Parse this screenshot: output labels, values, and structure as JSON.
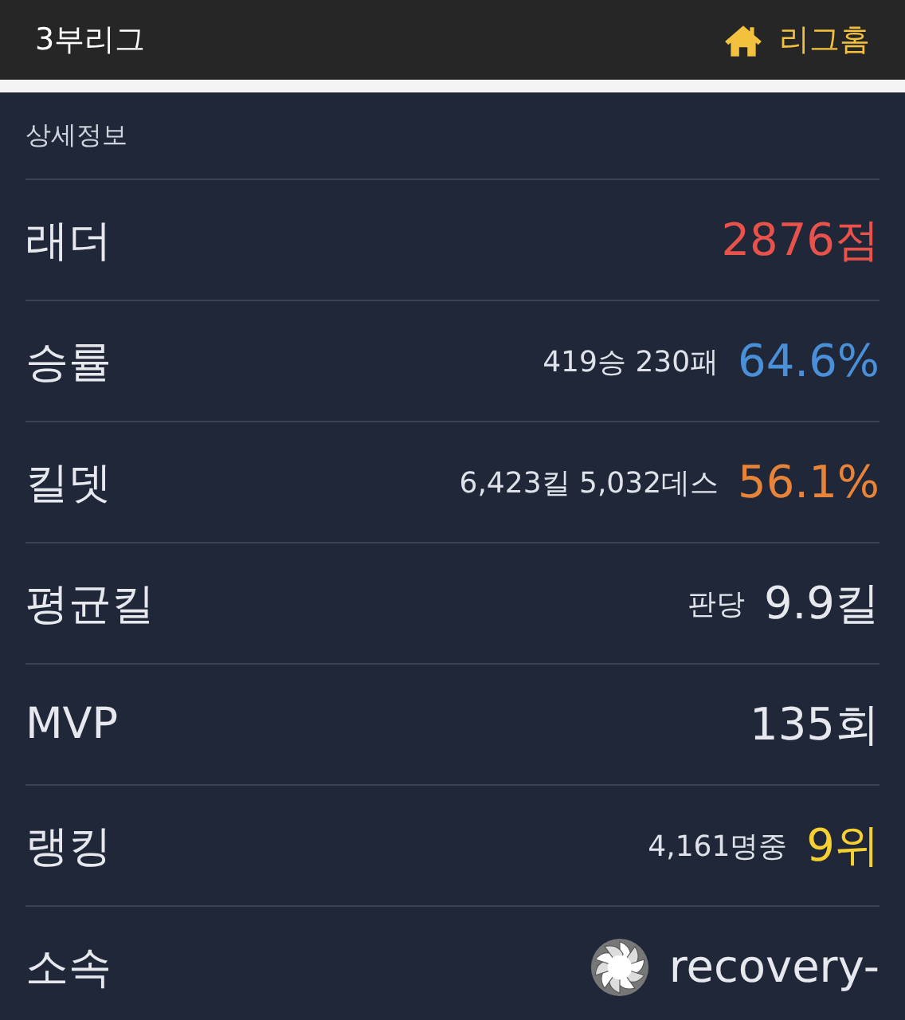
{
  "top_bar": {
    "title": "3부리그",
    "home_link": "리그홈"
  },
  "section": {
    "title": "상세정보"
  },
  "rows": [
    {
      "kind": "stat",
      "label": "래더",
      "detail": "",
      "value": "2876점",
      "color": "#e8524a"
    },
    {
      "kind": "stat",
      "label": "승률",
      "detail": "419승 230패",
      "value": "64.6%",
      "color": "#4a90d9"
    },
    {
      "kind": "stat",
      "label": "킬뎃",
      "detail": "6,423킬 5,032데스",
      "value": "56.1%",
      "color": "#e8833a"
    },
    {
      "kind": "stat",
      "label": "평균킬",
      "detail": "판당",
      "value": "9.9킬",
      "color": "#e6e8ee"
    },
    {
      "kind": "stat",
      "label": "MVP",
      "detail": "",
      "value": "135회",
      "color": "#e6e8ee"
    },
    {
      "kind": "stat",
      "label": "랭킹",
      "detail": "4,161명중",
      "value": "9위",
      "color": "#f5d033"
    },
    {
      "kind": "team",
      "label": "소속",
      "detail": "",
      "value": "recovery-",
      "color": "#e6e8ee"
    }
  ]
}
